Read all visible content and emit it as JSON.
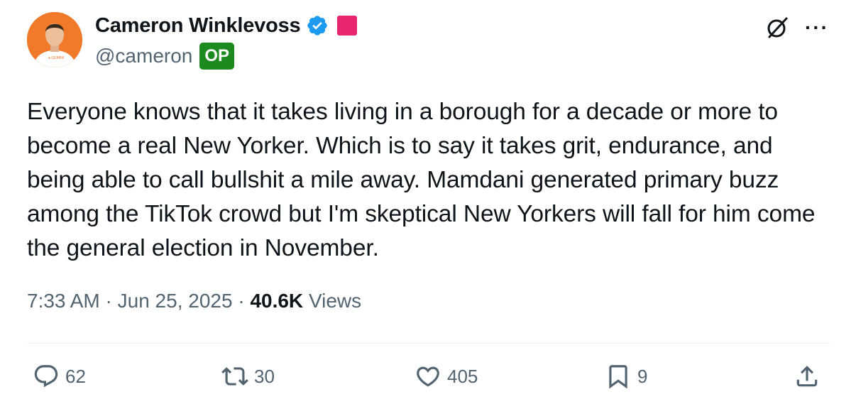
{
  "author": {
    "name": "Cameron Winklevoss",
    "handle": "@cameron",
    "op_label": "OP",
    "verified_color": "#1d9bf0",
    "badge_color": "#e8266f"
  },
  "post": {
    "text": "Everyone knows that it takes living in a borough for a decade or more to become a real New Yorker. Which is to say it takes grit, endurance, and being able to call bullshit a mile away. Mamdani generated primary buzz among the TikTok crowd but I'm skeptical New Yorkers will fall for him come the general election in November.",
    "time": "7:33 AM",
    "date": "Jun 25, 2025",
    "views_count": "40.6K",
    "views_label": "Views"
  },
  "actions": {
    "replies": "62",
    "reposts": "30",
    "likes": "405",
    "bookmarks": "9"
  },
  "icons": {
    "top": [
      "grok-icon",
      "more-icon"
    ],
    "bar": [
      "reply-icon",
      "repost-icon",
      "like-icon",
      "bookmark-icon",
      "share-icon"
    ]
  }
}
